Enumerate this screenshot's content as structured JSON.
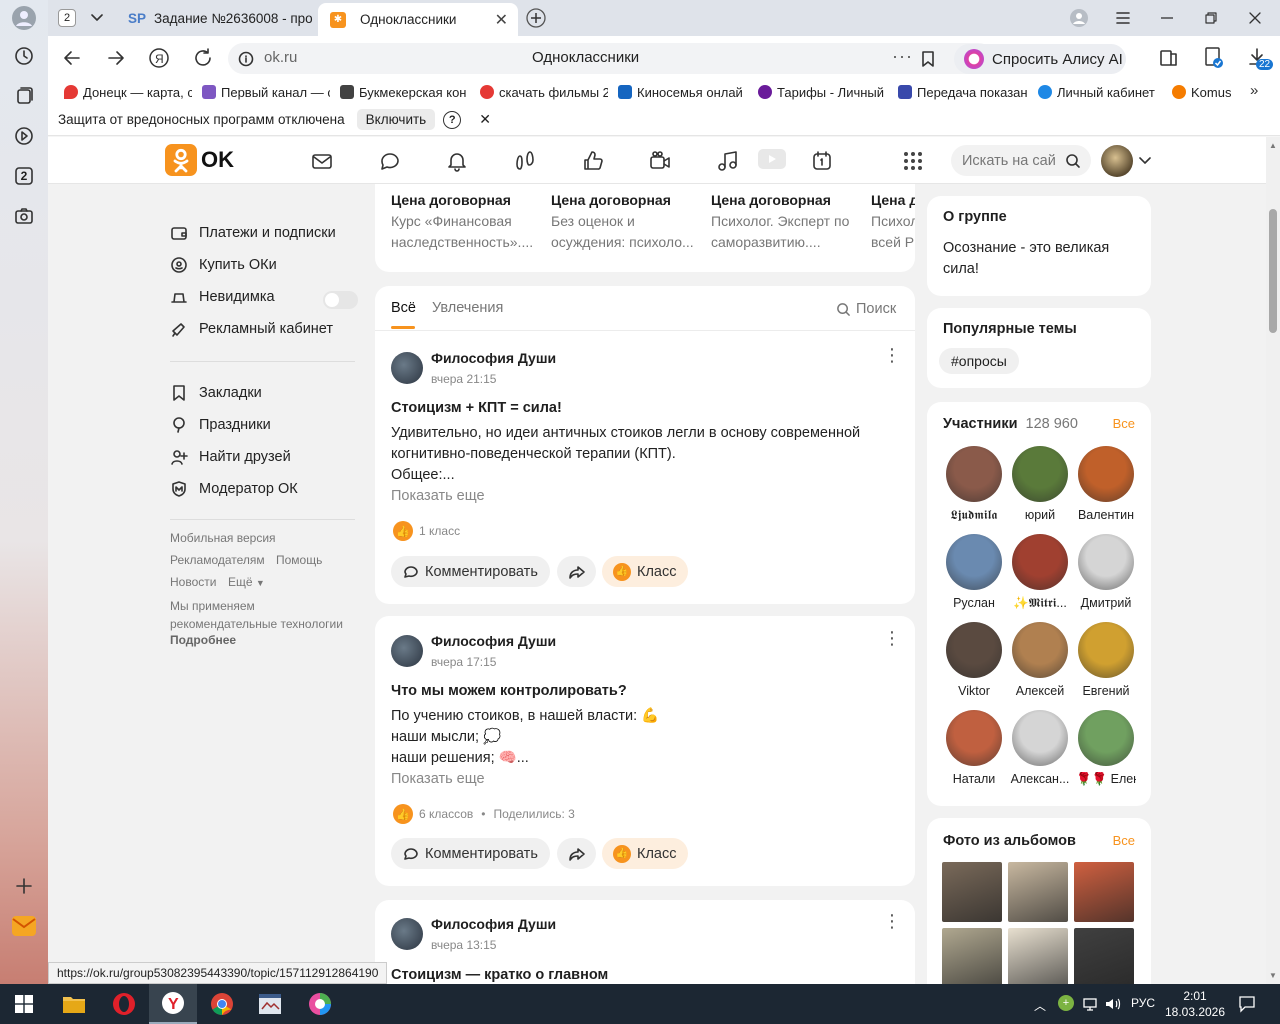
{
  "browser": {
    "tab_count": "2",
    "tabs": [
      {
        "label": "Задание №2636008 - про",
        "favicon": "SP"
      },
      {
        "label": "Одноклассники"
      }
    ],
    "url": "ok.ru",
    "page_title": "Одноклассники",
    "alice_label": "Спросить Алису AI",
    "downloads_count": "22",
    "rail_badge": "2",
    "bookmarks": [
      {
        "label": "Донецк — карта, с",
        "color": "#e53935"
      },
      {
        "label": "Первый канал — с",
        "color": "#7e57c2"
      },
      {
        "label": "Букмекерская кон",
        "color": "#424242"
      },
      {
        "label": "скачать фильмы 2",
        "color": "#e53935"
      },
      {
        "label": "Киносемья онлай",
        "color": "#1565c0"
      },
      {
        "label": "Тарифы - Личный",
        "color": "#6a1b9a"
      },
      {
        "label": "Передача показан",
        "color": "#3949ab"
      },
      {
        "label": "Личный кабинет",
        "color": "#1e88e5"
      },
      {
        "label": "Komus",
        "color": "#f57c00"
      }
    ],
    "protection_text": "Защита от вредоносных программ отключена",
    "protection_button": "Включить",
    "status_url": "https://ok.ru/group53082395443390/topic/157112912864190"
  },
  "ok": {
    "logo_text": "OK",
    "search_placeholder": "Искать на сай",
    "left_menu": [
      {
        "label": "Платежи и подписки",
        "icon": "wallet-icon"
      },
      {
        "label": "Купить ОКи",
        "icon": "coin-icon"
      },
      {
        "label": "Невидимка",
        "icon": "hat-icon"
      },
      {
        "label": "Рекламный кабинет",
        "icon": "megaphone-icon"
      }
    ],
    "left_menu2": [
      {
        "label": "Закладки",
        "icon": "bookmark-icon"
      },
      {
        "label": "Праздники",
        "icon": "balloon-icon"
      },
      {
        "label": "Найти друзей",
        "icon": "add-friend-icon"
      },
      {
        "label": "Модератор ОК",
        "icon": "moderator-icon"
      }
    ],
    "footer": {
      "mobile": "Мобильная версия",
      "advertisers": "Рекламодателям",
      "help": "Помощь",
      "news": "Новости",
      "more": "Ещё",
      "notice": "Мы применяем рекомендательные технологии",
      "details": "Подробнее"
    },
    "courses": [
      {
        "price": "Цена договорная",
        "desc1": "Курс «Финансовая",
        "desc2": "наследственность»...."
      },
      {
        "price": "Цена договорная",
        "desc1": "Без оценок и",
        "desc2": "осуждения: психоло..."
      },
      {
        "price": "Цена договорная",
        "desc1": "Психолог. Эксперт по",
        "desc2": "саморазвитию...."
      },
      {
        "price": "Цена д",
        "desc1": "Психол",
        "desc2": "всей Р"
      }
    ],
    "feed_tabs": {
      "all": "Всё",
      "hobbies": "Увлечения",
      "search": "Поиск"
    },
    "posts": [
      {
        "author": "Философия Души",
        "time": "вчера 21:15",
        "title": "Стоицизм + КПТ = сила!",
        "lines": [
          "Удивительно, но идеи античных стоиков легли в основу современной",
          "когнитивно-поведенческой терапии (КПТ).",
          "Общее:..."
        ],
        "more": "Показать еще",
        "likes": "1 класс",
        "shares": "",
        "comment_btn": "Комментировать",
        "klass_btn": "Класс"
      },
      {
        "author": "Философия Души",
        "time": "вчера 17:15",
        "title": "Что мы можем контролировать?",
        "lines": [
          "По учению стоиков, в нашей власти: 💪",
          "наши мысли; 💭",
          "наши решения; 🧠..."
        ],
        "more": "Показать еще",
        "likes": "6 классов",
        "shares": "Поделились: 3",
        "comment_btn": "Комментировать",
        "klass_btn": "Класс"
      },
      {
        "author": "Философия Души",
        "time": "вчера 13:15",
        "title": "Стоицизм — кратко о главном"
      }
    ],
    "about": {
      "title": "О группе",
      "text1": "Осознание - это великая",
      "text2": "сила!"
    },
    "topics": {
      "title": "Популярные темы",
      "tag": "#опросы"
    },
    "members": {
      "title": "Участники",
      "count": "128 960",
      "all": "Все",
      "list": [
        {
          "name": "𝕷𝖏𝖚𝖉𝖒𝖎𝖑𝖆",
          "color": "#8a5a4a"
        },
        {
          "name": "юрий",
          "color": "#5a7a3a"
        },
        {
          "name": "Валентин",
          "color": "#c0602a"
        },
        {
          "name": "Руслан",
          "color": "#6a8ab0"
        },
        {
          "name": "✨𝕸𝖎𝖙𝖗𝖎...",
          "color": "#a04030"
        },
        {
          "name": "Дмитрий",
          "color": "#d5d5d5"
        },
        {
          "name": "Viktor",
          "color": "#5a4a40"
        },
        {
          "name": "Алексей",
          "color": "#b08050"
        },
        {
          "name": "Евгений",
          "color": "#d0a030"
        },
        {
          "name": "Натали",
          "color": "#c06040"
        },
        {
          "name": "Алексан...",
          "color": "#d5d5d5"
        },
        {
          "name": "🌹🌹 Елена",
          "color": "#70a060"
        }
      ]
    },
    "photos": {
      "title": "Фото из альбомов",
      "all": "Все",
      "colors": [
        "#7a6a5a",
        "#c8b8a0",
        "#d06040",
        "#b0a890",
        "#e8e0d0",
        "#404040"
      ]
    }
  },
  "taskbar": {
    "lang": "РУС",
    "time": "2:01",
    "date": "18.03.2026"
  }
}
